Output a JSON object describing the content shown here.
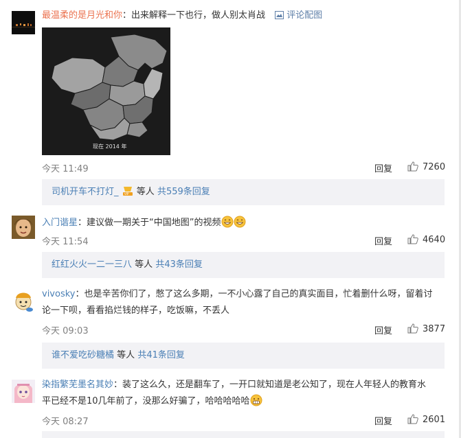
{
  "comments": [
    {
      "username": "最温柔的是月光和你",
      "text": "出来解释一下也行，做人别太肖战",
      "pic_comment_label": "评论配图",
      "image_caption": "现在 2014 年",
      "time": "今天 11:49",
      "reply_label": "回复",
      "likes": "7260",
      "replies": {
        "user": "司机开车不打灯_",
        "suffix": "等人",
        "count_label": "共559条回复"
      }
    },
    {
      "username": "入门谐星",
      "text": "建议做一期关于“中国地图”的视频",
      "time": "今天 11:54",
      "reply_label": "回复",
      "likes": "4640",
      "replies": {
        "user": "红红火火一二一三八",
        "suffix": "等人",
        "count_label": "共43条回复"
      }
    },
    {
      "username": "vivosky",
      "text_line1": "也是辛苦你们了，憋了这么多期，一不小心露了自己的真实面目，忙着删什么呀，留着讨",
      "text_line2": "论一下呗，看看掐烂钱的样子，吃饭嘛，不丢人",
      "time": "今天 09:03",
      "reply_label": "回复",
      "likes": "3877",
      "replies": {
        "user": "谁不爱吃砂糖橘",
        "suffix": "等人",
        "count_label": "共41条回复"
      }
    },
    {
      "username": "染指繁芜墨名其妙",
      "text_line1": "装了这么久，还是翻车了，一开口就知道是老公知了，现在人年轻人的教育水",
      "text_line2": "平已经不是10几年前了，没那么好骗了，哈哈哈哈哈",
      "time": "今天 08:27",
      "reply_label": "回复",
      "likes": "2601"
    }
  ],
  "colors": {
    "username": "#eb7350",
    "link": "#4a7fb5",
    "reply_bg": "#f2f2f5"
  }
}
